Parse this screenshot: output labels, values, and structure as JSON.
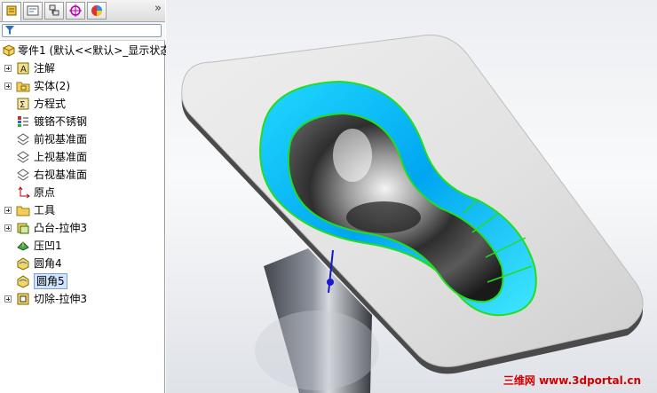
{
  "feature_tree": {
    "filter_icon": "funnel-icon",
    "part_root": "零件1  (默认<<默认>_显示状态",
    "items": [
      {
        "label": "注解",
        "icon": "annotations-icon",
        "expandable": true
      },
      {
        "label": "实体(2)",
        "icon": "solid-bodies-icon",
        "expandable": true
      },
      {
        "label": "方程式",
        "icon": "equations-icon",
        "expandable": false
      },
      {
        "label": "镀铬不锈钢",
        "icon": "material-icon",
        "expandable": false
      },
      {
        "label": "前视基准面",
        "icon": "plane-icon",
        "expandable": false
      },
      {
        "label": "上视基准面",
        "icon": "plane-icon",
        "expandable": false
      },
      {
        "label": "右视基准面",
        "icon": "plane-icon",
        "expandable": false
      },
      {
        "label": "原点",
        "icon": "origin-icon",
        "expandable": false
      },
      {
        "label": "工具",
        "icon": "folder-icon",
        "expandable": true
      },
      {
        "label": "凸台-拉伸3",
        "icon": "boss-extrude-icon",
        "expandable": true
      },
      {
        "label": "压凹1",
        "icon": "indent-icon",
        "expandable": false
      },
      {
        "label": "圆角4",
        "icon": "fillet-icon",
        "expandable": false
      },
      {
        "label": "圆角5",
        "icon": "fillet-icon",
        "expandable": false,
        "selected": true
      },
      {
        "label": "切除-拉伸3",
        "icon": "cut-extrude-icon",
        "expandable": true
      }
    ]
  },
  "tabs": [
    "feature-manager-tab",
    "property-manager-tab",
    "configuration-manager-tab",
    "dimxpert-tab",
    "display-manager-tab"
  ],
  "more_glyph": "»",
  "watermark": "三维网 www.3dportal.cn",
  "colors": {
    "selection": "#cfe3fc",
    "highlight": "#22dd22",
    "cyan": "#00c8ff",
    "watermark": "#d40000"
  }
}
